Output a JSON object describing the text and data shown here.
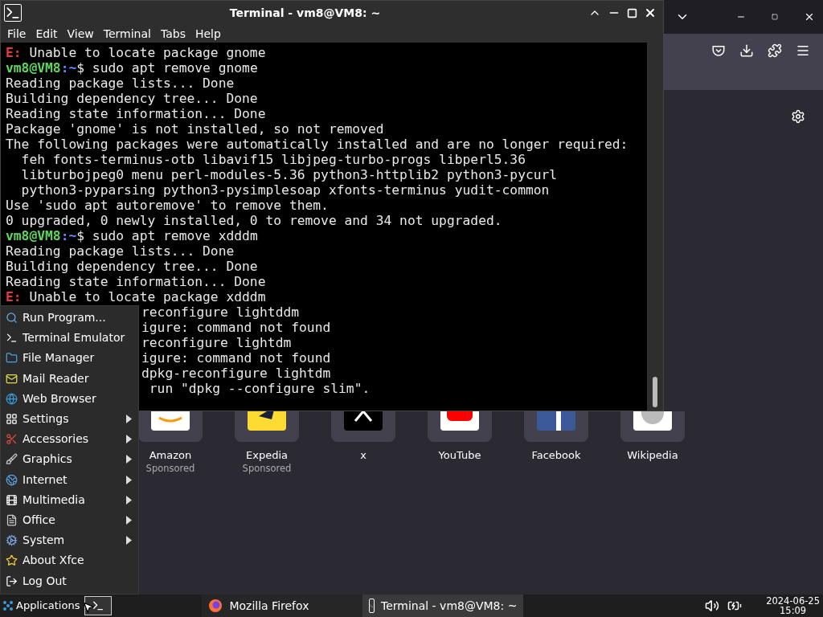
{
  "terminal": {
    "title": "Terminal - vm8@VM8: ~",
    "menu": [
      "File",
      "Edit",
      "View",
      "Terminal",
      "Tabs",
      "Help"
    ],
    "lines": [
      {
        "kind": "error",
        "tag": "E:",
        "text": " Unable to locate package gnome"
      },
      {
        "kind": "prompt",
        "user": "vm8@VM8",
        "dir": ":~",
        "text": "$ sudo apt remove gnome"
      },
      {
        "kind": "plain",
        "text": "Reading package lists... Done"
      },
      {
        "kind": "plain",
        "text": "Building dependency tree... Done"
      },
      {
        "kind": "plain",
        "text": "Reading state information... Done"
      },
      {
        "kind": "plain",
        "text": "Package 'gnome' is not installed, so not removed"
      },
      {
        "kind": "plain",
        "text": "The following packages were automatically installed and are no longer required:"
      },
      {
        "kind": "plain",
        "text": "  feh fonts-terminus-otb libavif15 libjpeg-turbo-progs libperl5.36"
      },
      {
        "kind": "plain",
        "text": "  libturbojpeg0 menu perl-modules-5.36 python3-httplib2 python3-pycurl"
      },
      {
        "kind": "plain",
        "text": "  python3-pyparsing python3-pysimplesoap xfonts-terminus yudit-common"
      },
      {
        "kind": "plain",
        "text": "Use 'sudo apt autoremove' to remove them."
      },
      {
        "kind": "plain",
        "text": "0 upgraded, 0 newly installed, 0 to remove and 34 not upgraded."
      },
      {
        "kind": "prompt",
        "user": "vm8@VM8",
        "dir": ":~",
        "text": "$ sudo apt remove xdddm"
      },
      {
        "kind": "plain",
        "text": "Reading package lists... Done"
      },
      {
        "kind": "plain",
        "text": "Building dependency tree... Done"
      },
      {
        "kind": "plain",
        "text": "Reading state information... Done"
      },
      {
        "kind": "error",
        "tag": "E:",
        "text": " Unable to locate package xdddm"
      },
      {
        "kind": "clipped",
        "text": "reconfigure lightddm"
      },
      {
        "kind": "clipped",
        "text": "igure: command not found"
      },
      {
        "kind": "clipped",
        "text": "reconfigure lightdm"
      },
      {
        "kind": "clipped",
        "text": "igure: command not found"
      },
      {
        "kind": "clipped",
        "text": "dpkg-reconfigure lightdm"
      },
      {
        "kind": "clipped",
        "text": " run \"dpkg --configure slim\"."
      }
    ]
  },
  "browser": {
    "shortcuts": [
      {
        "label": "Amazon",
        "sponsor": "Sponsored"
      },
      {
        "label": "Expedia",
        "sponsor": "Sponsored"
      },
      {
        "label": "x"
      },
      {
        "label": "YouTube"
      },
      {
        "label": "Facebook"
      },
      {
        "label": "Wikipedia"
      }
    ]
  },
  "app_menu": {
    "items": [
      {
        "label": "Run Program...",
        "submenu": false
      },
      {
        "label": "Terminal Emulator",
        "submenu": false
      },
      {
        "label": "File Manager",
        "submenu": false
      },
      {
        "label": "Mail Reader",
        "submenu": false
      },
      {
        "label": "Web Browser",
        "submenu": false
      },
      {
        "label": "Settings",
        "submenu": true
      },
      {
        "label": "Accessories",
        "submenu": true
      },
      {
        "label": "Graphics",
        "submenu": true
      },
      {
        "label": "Internet",
        "submenu": true
      },
      {
        "label": "Multimedia",
        "submenu": true
      },
      {
        "label": "Office",
        "submenu": true
      },
      {
        "label": "System",
        "submenu": true
      },
      {
        "label": "About Xfce",
        "submenu": false
      },
      {
        "label": "Log Out",
        "submenu": false
      }
    ]
  },
  "taskbar": {
    "apps_label": "Applications",
    "tasks": [
      {
        "label": "Mozilla Firefox",
        "selected": false
      },
      {
        "label": "Terminal - vm8@VM8: ~",
        "selected": true
      }
    ],
    "date": "2024-06-25",
    "time": "15:09"
  }
}
